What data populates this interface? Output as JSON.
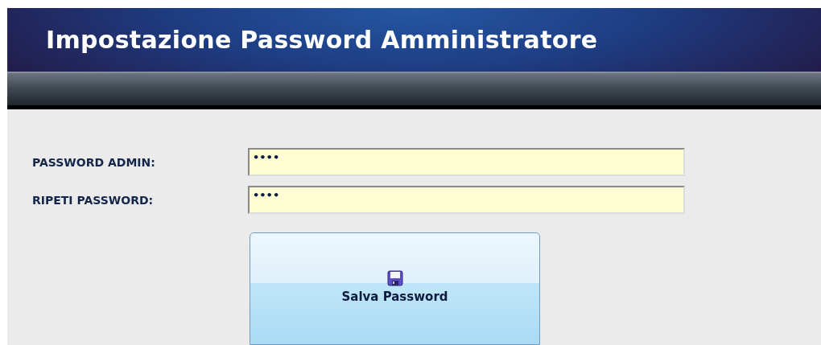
{
  "window": {
    "title": "Impostazione Password Amministratore"
  },
  "fields": [
    {
      "label": "PASSWORD ADMIN:",
      "value": "••••"
    },
    {
      "label": "RIPETI PASSWORD:",
      "value": "••••"
    }
  ],
  "save_button": {
    "label": "Salva Password"
  }
}
